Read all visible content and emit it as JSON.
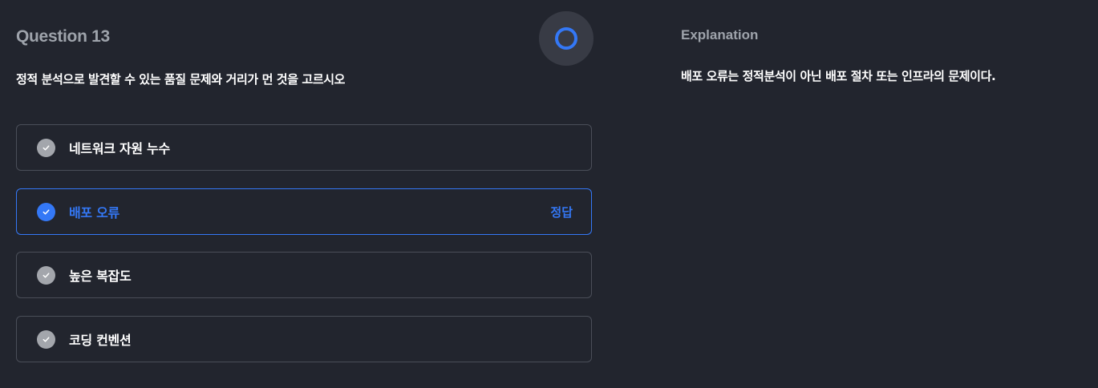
{
  "question": {
    "title": "Question 13",
    "text": "정적 분석으로 발견할 수 있는 품질 문제와 거리가 먼 것을 고르시오",
    "result_icon": "circle-correct-icon"
  },
  "options": [
    {
      "label": "네트워크 자원 누수",
      "correct": false,
      "tag": ""
    },
    {
      "label": "배포 오류",
      "correct": true,
      "tag": "정답"
    },
    {
      "label": "높은 복잡도",
      "correct": false,
      "tag": ""
    },
    {
      "label": "코딩 컨벤션",
      "correct": false,
      "tag": ""
    }
  ],
  "explanation": {
    "title": "Explanation",
    "text": "배포 오류는 정적분석이 아닌 배포 절차 또는 인프라의 문제이다."
  },
  "colors": {
    "accent": "#3478f6",
    "background": "#22252e",
    "muted_text": "#9ea3ab",
    "border": "#4a4e58"
  }
}
